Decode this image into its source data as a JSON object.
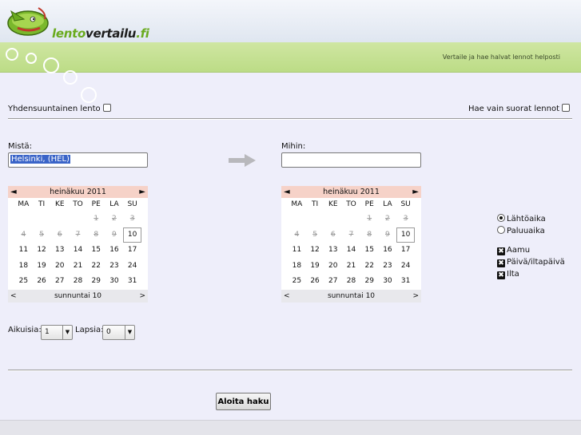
{
  "header": {
    "logo_part1": "lento",
    "logo_part2": "vertailu",
    "logo_part3": ".fi",
    "tagline": "Vertaile ja hae halvat lennot helposti",
    "colors": {
      "brand_green": "#6aab1f",
      "bar_green": "#c4e08f",
      "page_bg": "#eeeefa"
    }
  },
  "options": {
    "one_way_label": "Yhdensuuntainen lento",
    "direct_only_label": "Hae vain suorat lennot"
  },
  "origin": {
    "label": "Mistä:",
    "value": "Helsinki, (HEL)"
  },
  "destination": {
    "label": "Mihin:",
    "value": ""
  },
  "calendar_left": {
    "month": "heinäkuu 2011",
    "prev": "◄",
    "next": "►",
    "weekdays": [
      "MA",
      "TI",
      "KE",
      "TO",
      "PE",
      "LA",
      "SU"
    ],
    "today_label": "sunnuntai 10",
    "foot_prev": "<",
    "foot_next": ">"
  },
  "calendar_right": {
    "month": "heinäkuu 2011",
    "prev": "◄",
    "next": "►",
    "weekdays": [
      "MA",
      "TI",
      "KE",
      "TO",
      "PE",
      "LA",
      "SU"
    ],
    "today_label": "sunnuntai 10",
    "foot_prev": "<",
    "foot_next": ">"
  },
  "calendar_days": [
    [
      "",
      "",
      "",
      "",
      "1",
      "2",
      "3"
    ],
    [
      "4",
      "5",
      "6",
      "7",
      "8",
      "9",
      "10"
    ],
    [
      "11",
      "12",
      "13",
      "14",
      "15",
      "16",
      "17"
    ],
    [
      "18",
      "19",
      "20",
      "21",
      "22",
      "23",
      "24"
    ],
    [
      "25",
      "26",
      "27",
      "28",
      "29",
      "30",
      "31"
    ]
  ],
  "calendar_past_until": 9,
  "calendar_today": 10,
  "time_mode": {
    "departure_label": "Lähtöaika",
    "return_label": "Paluuaika",
    "selected": "departure"
  },
  "time_of_day": {
    "morning": "Aamu",
    "afternoon": "Päivä/iltapäivä",
    "evening": "Ilta",
    "check_glyph": "✖"
  },
  "passengers": {
    "adults_label": "Aikuisia:",
    "adults_value": "1",
    "children_label": "Lapsia:",
    "children_value": "0",
    "dropdown_glyph": "▼"
  },
  "search_button": "Aloita haku"
}
